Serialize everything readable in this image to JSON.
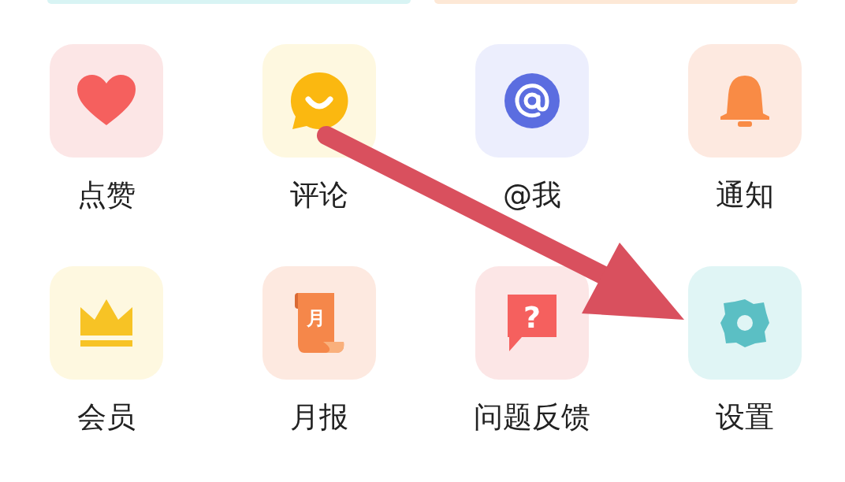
{
  "top_cards": [
    {
      "kind": "cyan"
    },
    {
      "kind": "orange"
    }
  ],
  "grid": [
    {
      "label": "点赞",
      "kind": "heart"
    },
    {
      "label": "评论",
      "kind": "comment"
    },
    {
      "label": "@我",
      "kind": "at"
    },
    {
      "label": "通知",
      "kind": "bell"
    },
    {
      "label": "会员",
      "kind": "crown"
    },
    {
      "label": "月报",
      "kind": "scroll",
      "badge": "月"
    },
    {
      "label": "问题反馈",
      "kind": "question",
      "badge": "?"
    },
    {
      "label": "设置",
      "kind": "gear"
    }
  ],
  "annotation": {
    "kind": "arrow"
  }
}
